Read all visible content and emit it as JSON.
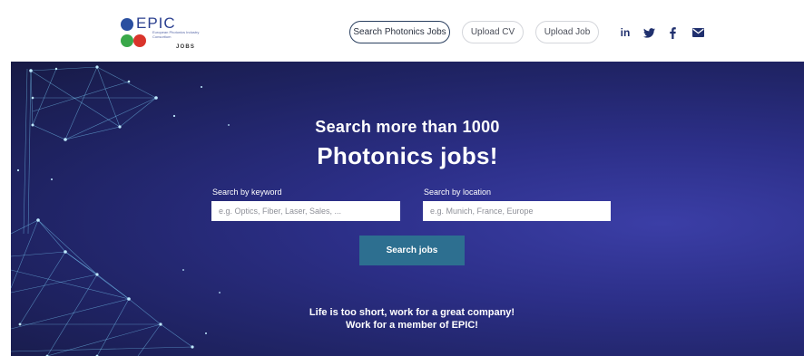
{
  "header": {
    "logo": {
      "word": "EPIC",
      "subtitle": "European Photonics Industry Consortium",
      "jobs": "JOBS",
      "colors": {
        "blue": "#2a4fa0",
        "green": "#3aa84a",
        "red": "#d9342b"
      }
    },
    "nav": {
      "search_jobs": "Search Photonics Jobs",
      "upload_cv": "Upload CV",
      "upload_job": "Upload Job"
    },
    "social": {
      "linkedin": "in",
      "icons": [
        "linkedin-icon",
        "twitter-icon",
        "facebook-icon",
        "mail-icon"
      ]
    }
  },
  "hero": {
    "title_line1": "Search more than 1000",
    "title_line2": "Photonics jobs!",
    "keyword": {
      "label": "Search by keyword",
      "placeholder": "e.g. Optics, Fiber, Laser, Sales, ..."
    },
    "location": {
      "label": "Search by location",
      "placeholder": "e.g. Munich, France, Europe"
    },
    "search_button": "Search jobs",
    "tagline_line1": "Life is too short, work for a great company!",
    "tagline_line2": "Work for a member of EPIC!"
  },
  "colors": {
    "brand_navy": "#20306e",
    "button": "#2d6f90",
    "hero_background": "#2c2f88"
  }
}
